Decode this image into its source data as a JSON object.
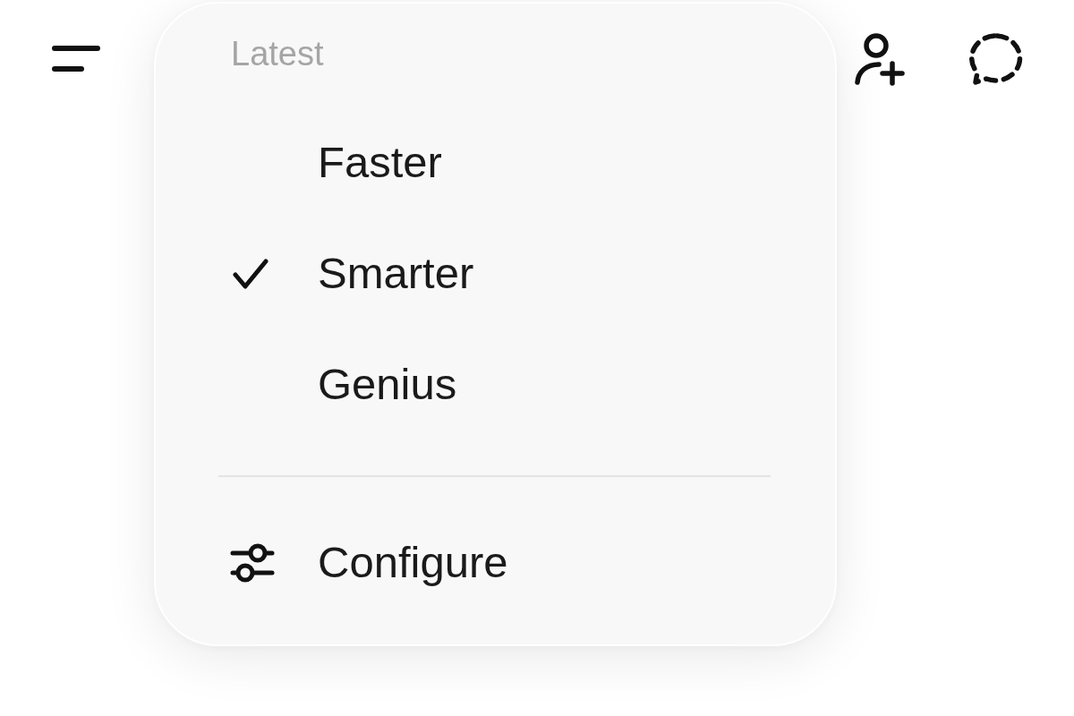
{
  "menu": {
    "section_label": "Latest",
    "items": [
      {
        "label": "Faster",
        "selected": false
      },
      {
        "label": "Smarter",
        "selected": true
      },
      {
        "label": "Genius",
        "selected": false
      }
    ],
    "action": {
      "label": "Configure"
    }
  }
}
